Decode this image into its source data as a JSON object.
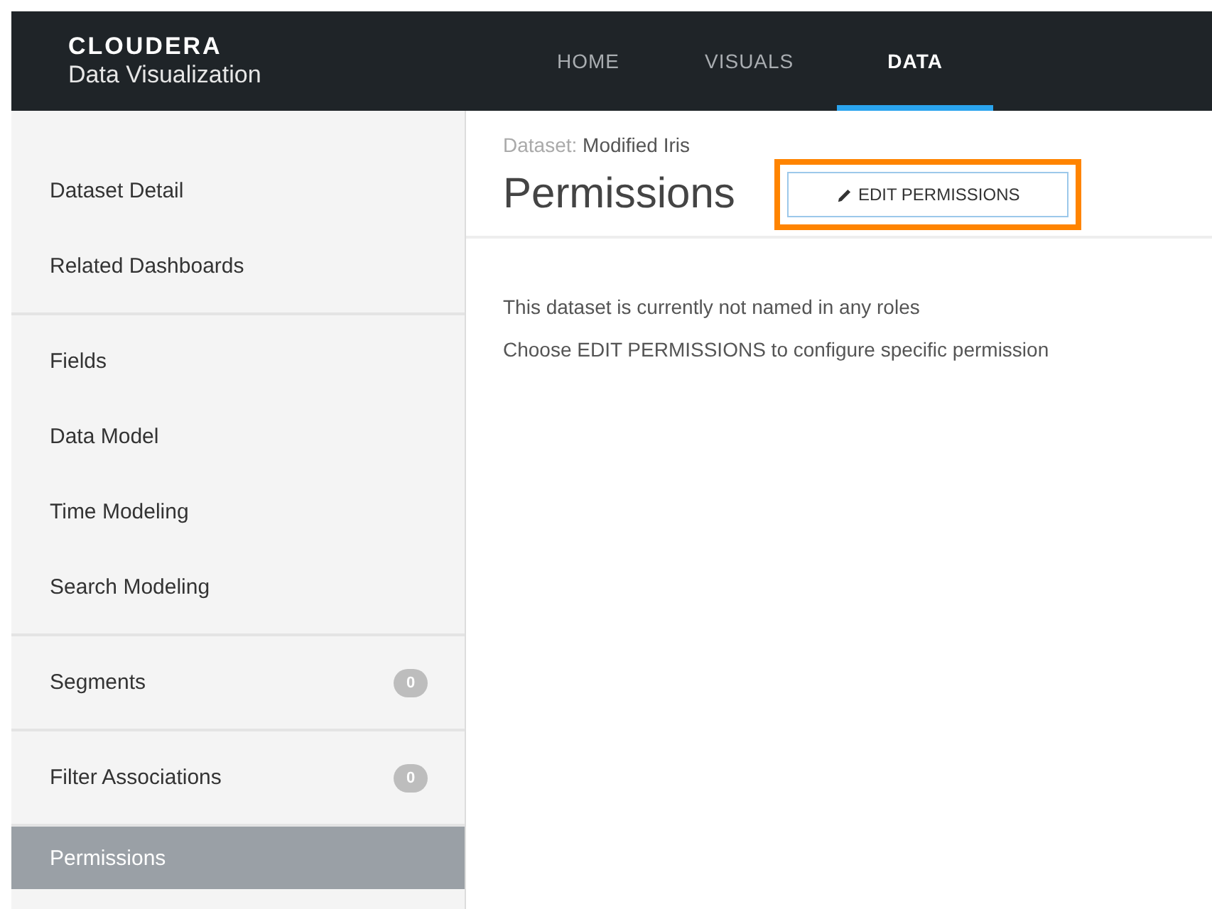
{
  "header": {
    "brand": "CLOUDERA",
    "product": "Data Visualization",
    "nav": [
      {
        "label": "HOME",
        "selected": false
      },
      {
        "label": "VISUALS",
        "selected": false
      },
      {
        "label": "DATA",
        "selected": true
      }
    ]
  },
  "sidebar": {
    "groups": [
      {
        "items": [
          {
            "label": "Dataset Detail",
            "selected": false
          },
          {
            "label": "Related Dashboards",
            "selected": false
          }
        ]
      },
      {
        "items": [
          {
            "label": "Fields",
            "selected": false
          },
          {
            "label": "Data Model",
            "selected": false
          },
          {
            "label": "Time Modeling",
            "selected": false
          },
          {
            "label": "Search Modeling",
            "selected": false
          }
        ]
      },
      {
        "items": [
          {
            "label": "Segments",
            "badge": "0",
            "selected": false
          }
        ]
      },
      {
        "items": [
          {
            "label": "Filter Associations",
            "badge": "0",
            "selected": false
          }
        ]
      },
      {
        "items": [
          {
            "label": "Permissions",
            "selected": true
          }
        ]
      }
    ]
  },
  "main": {
    "breadcrumb_label": "Dataset:",
    "breadcrumb_value": "Modified Iris",
    "title": "Permissions",
    "edit_button": {
      "label": "EDIT PERMISSIONS",
      "highlighted": true
    },
    "messages": [
      "This dataset is currently not named in any roles",
      "Choose EDIT PERMISSIONS to configure specific permission"
    ]
  }
}
